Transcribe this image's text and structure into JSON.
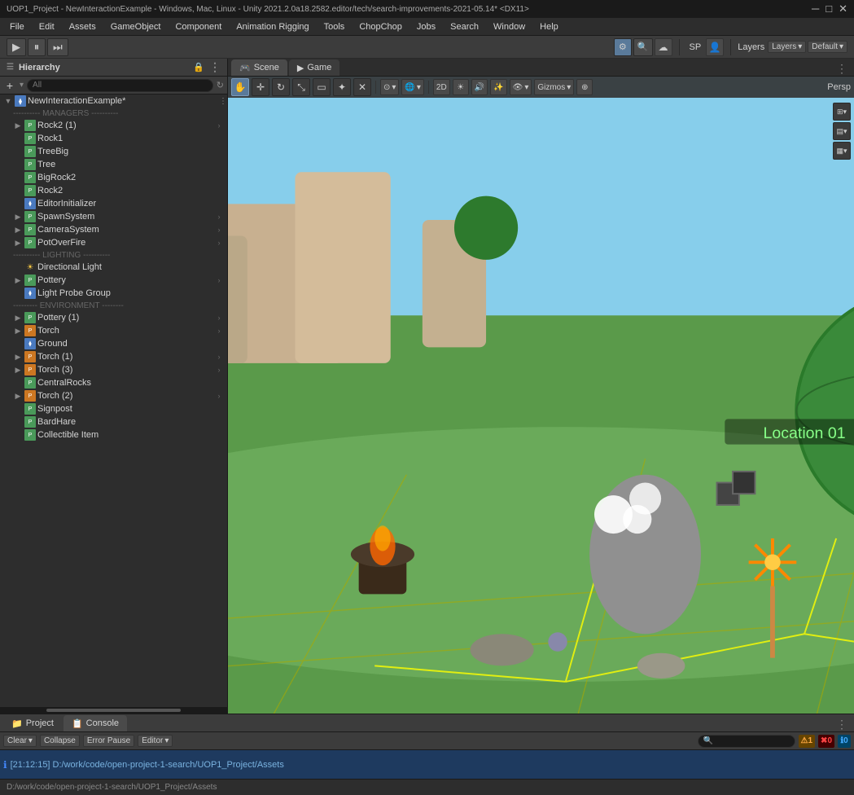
{
  "titlebar": {
    "title": "UOP1_Project - NewInteractionExample - Windows, Mac, Linux - Unity 2021.2.0a18.2582.editor/tech/search-improvements-2021-05.14* <DX11>",
    "minimize": "─",
    "maximize": "□",
    "close": "✕"
  },
  "menubar": {
    "items": [
      "File",
      "Edit",
      "Assets",
      "GameObject",
      "Component",
      "Animation Rigging",
      "Tools",
      "ChopChop",
      "Jobs",
      "Search",
      "Window",
      "Help"
    ]
  },
  "toolbar": {
    "layers_label": "Layers",
    "default_label": "Default",
    "sp_label": "SP",
    "account_icon": "👤"
  },
  "hierarchy": {
    "panel_title": "Hierarchy",
    "search_placeholder": "All",
    "items": [
      {
        "label": "NewInteractionExample*",
        "indent": 0,
        "type": "root",
        "expanded": true,
        "has_children": true
      },
      {
        "label": "---------- MANAGERS ----------",
        "indent": 1,
        "type": "separator"
      },
      {
        "label": "Rock2 (1)",
        "indent": 1,
        "type": "prefab",
        "has_children": true
      },
      {
        "label": "Rock1",
        "indent": 1,
        "type": "prefab"
      },
      {
        "label": "TreeBig",
        "indent": 1,
        "type": "prefab"
      },
      {
        "label": "Tree",
        "indent": 1,
        "type": "prefab"
      },
      {
        "label": "BigRock2",
        "indent": 1,
        "type": "prefab"
      },
      {
        "label": "Rock2",
        "indent": 1,
        "type": "prefab"
      },
      {
        "label": "EditorInitializer",
        "indent": 1,
        "type": "prefab"
      },
      {
        "label": "SpawnSystem",
        "indent": 1,
        "type": "prefab",
        "has_children": true
      },
      {
        "label": "CameraSystem",
        "indent": 1,
        "type": "prefab",
        "has_children": true
      },
      {
        "label": "PotOverFire",
        "indent": 1,
        "type": "prefab",
        "has_children": true
      },
      {
        "label": "---------- LIGHTING ----------",
        "indent": 1,
        "type": "separator"
      },
      {
        "label": "Directional Light",
        "indent": 1,
        "type": "light"
      },
      {
        "label": "Pottery",
        "indent": 1,
        "type": "prefab",
        "has_children": true
      },
      {
        "label": "Light Probe Group",
        "indent": 1,
        "type": "probe"
      },
      {
        "label": "--------- ENVIRONMENT --------",
        "indent": 1,
        "type": "separator"
      },
      {
        "label": "Pottery (1)",
        "indent": 1,
        "type": "prefab",
        "has_children": true
      },
      {
        "label": "Torch",
        "indent": 1,
        "type": "torch",
        "has_children": true
      },
      {
        "label": "Ground",
        "indent": 1,
        "type": "prefab"
      },
      {
        "label": "Torch (1)",
        "indent": 1,
        "type": "torch",
        "has_children": true
      },
      {
        "label": "Torch (3)",
        "indent": 1,
        "type": "torch",
        "has_children": true
      },
      {
        "label": "CentralRocks",
        "indent": 1,
        "type": "prefab"
      },
      {
        "label": "Torch (2)",
        "indent": 1,
        "type": "torch",
        "has_children": true
      },
      {
        "label": "Signpost",
        "indent": 1,
        "type": "prefab"
      },
      {
        "label": "BardHare",
        "indent": 1,
        "type": "prefab"
      },
      {
        "label": "Collectible Item",
        "indent": 1,
        "type": "prefab"
      }
    ]
  },
  "scene": {
    "tabs": [
      {
        "label": "Scene",
        "icon": "🎮",
        "active": true
      },
      {
        "label": "Game",
        "icon": "▶",
        "active": false
      }
    ],
    "persp_label": "Persp",
    "viewport_hint": "Location 01"
  },
  "console": {
    "tabs": [
      "Project",
      "Console"
    ],
    "active_tab": "Console",
    "toolbar": {
      "clear_label": "Clear",
      "collapse_label": "Collapse",
      "error_pause_label": "Error Pause",
      "editor_label": "Editor"
    },
    "badges": {
      "warn_count": "1",
      "err_count": "0",
      "info_count": "0"
    },
    "message": "[21:12:15] D:/work/code/open-project-1-search/UOP1_Project/Assets"
  },
  "statusbar": {
    "path": "D:/work/code/open-project-1-search/UOP1_Project/Assets"
  },
  "colors": {
    "accent_blue": "#2c5282",
    "bg_dark": "#1a1a1a",
    "bg_mid": "#2d2d2d",
    "bg_light": "#3c3c3c",
    "border": "#1a1a1a",
    "text_primary": "#d4d4d4",
    "text_muted": "#888888",
    "prefab_green": "#4aaa6a",
    "torch_orange": "#ff8844",
    "light_yellow": "#ffcc44"
  }
}
